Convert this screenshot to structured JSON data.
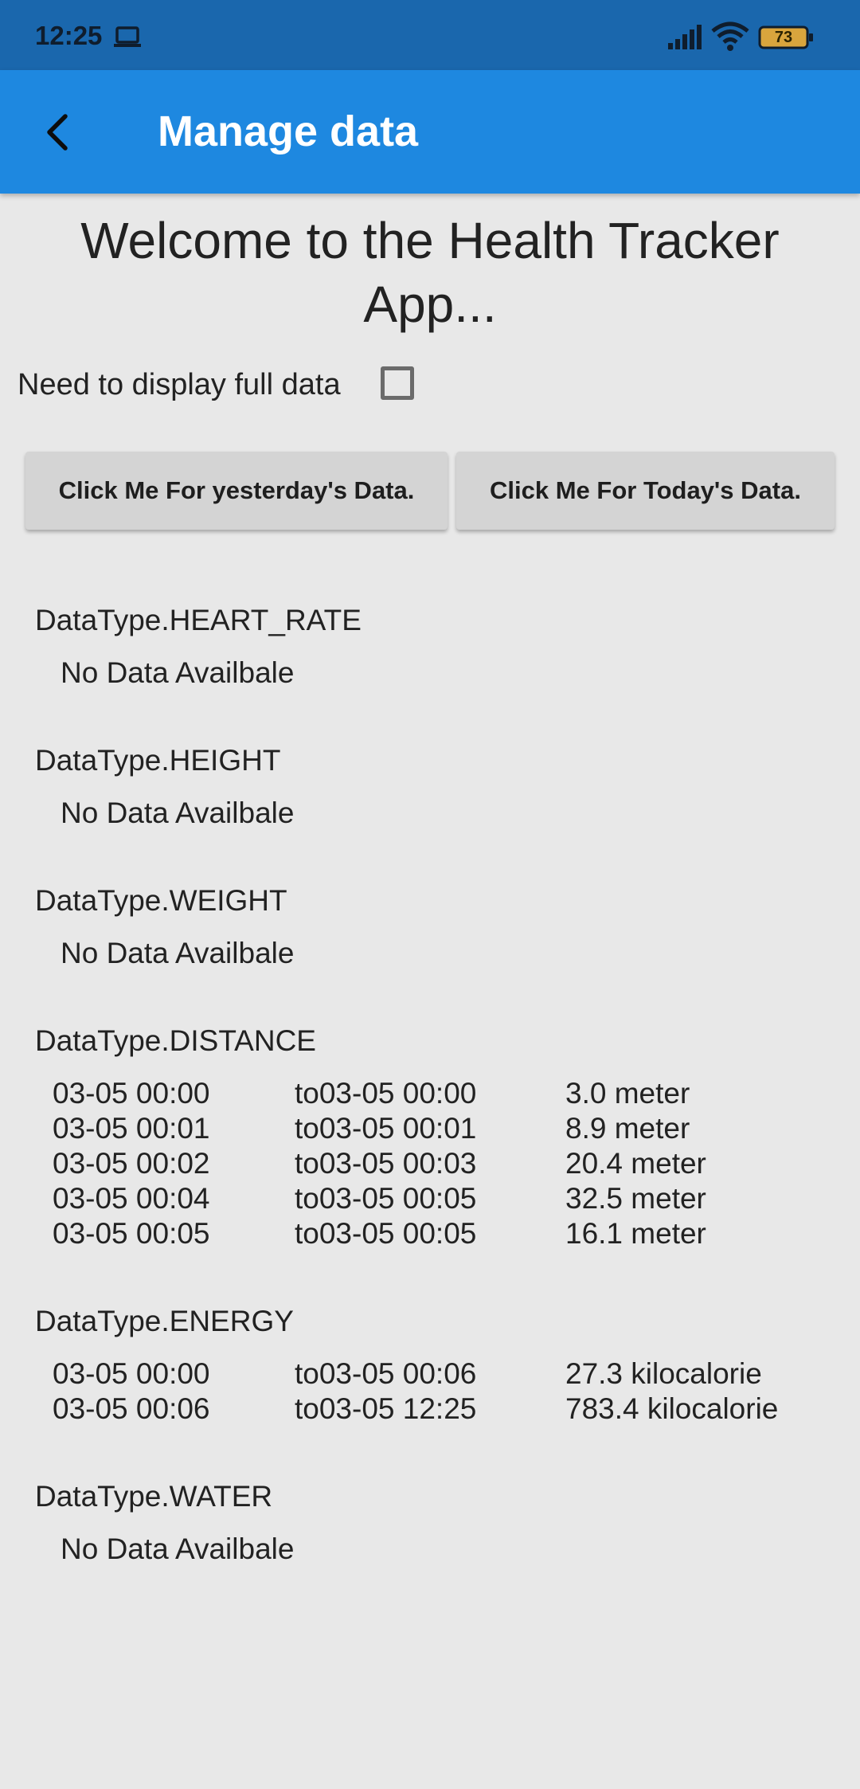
{
  "status_bar": {
    "time": "12:25",
    "battery": "73"
  },
  "app_bar": {
    "title": "Manage data",
    "back_icon": "arrow-back-icon"
  },
  "welcome_text": "Welcome to the Health Tracker App...",
  "full_data_option": {
    "label": "Need to display full data",
    "checked": false
  },
  "buttons": {
    "yesterday": "Click Me For yesterday's Data.",
    "today": "Click Me For Today's Data."
  },
  "sections": {
    "heart_rate": {
      "title": "DataType.HEART_RATE",
      "no_data": "No Data Availbale"
    },
    "height": {
      "title": "DataType.HEIGHT",
      "no_data": "No Data Availbale"
    },
    "weight": {
      "title": "DataType.WEIGHT",
      "no_data": "No Data Availbale"
    },
    "distance": {
      "title": "DataType.DISTANCE",
      "rows": [
        {
          "from": "03-05 00:00",
          "to": "to03-05 00:00",
          "value": "3.0 meter"
        },
        {
          "from": "03-05 00:01",
          "to": "to03-05 00:01",
          "value": "8.9 meter"
        },
        {
          "from": "03-05 00:02",
          "to": "to03-05 00:03",
          "value": "20.4 meter"
        },
        {
          "from": "03-05 00:04",
          "to": "to03-05 00:05",
          "value": "32.5 meter"
        },
        {
          "from": "03-05 00:05",
          "to": "to03-05 00:05",
          "value": "16.1 meter"
        }
      ]
    },
    "energy": {
      "title": "DataType.ENERGY",
      "rows": [
        {
          "from": "03-05 00:00",
          "to": "to03-05 00:06",
          "value": "27.3 kilocalorie"
        },
        {
          "from": "03-05 00:06",
          "to": "to03-05 12:25",
          "value": "783.4 kilocalorie"
        }
      ]
    },
    "water": {
      "title": "DataType.WATER",
      "no_data": "No Data Availbale"
    }
  },
  "colors": {
    "status_bar": "#1a67ad",
    "app_bar": "#1e88e0",
    "background": "#e8e8e8",
    "button": "#d4d4d4"
  }
}
